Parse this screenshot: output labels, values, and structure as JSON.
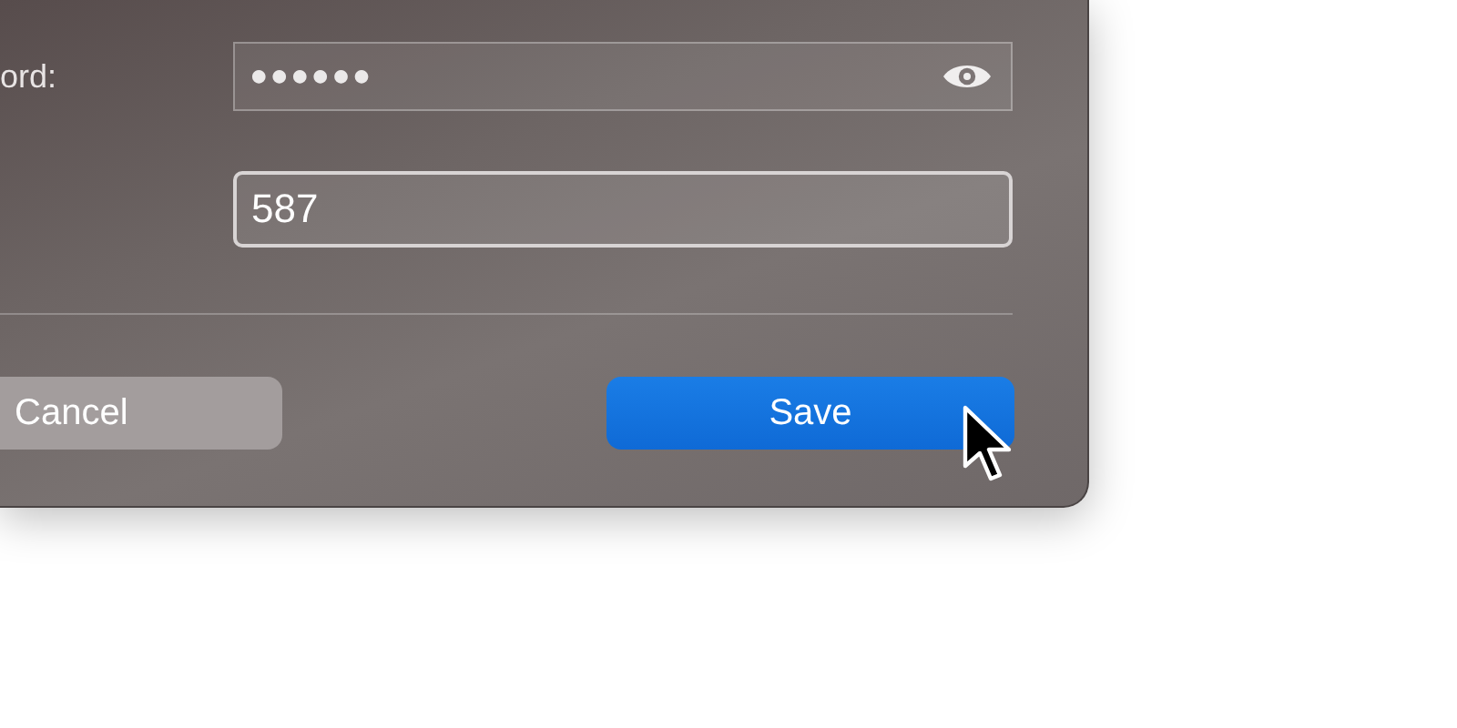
{
  "fields": [
    {
      "kind": "password",
      "label": "ord:",
      "value": "●●●●●●",
      "focused": false
    },
    {
      "kind": "text",
      "value": "587",
      "focused": true
    }
  ],
  "buttons": [
    {
      "label": "Cancel",
      "kind": "secondary"
    },
    {
      "label": "Save",
      "kind": "primary"
    }
  ]
}
